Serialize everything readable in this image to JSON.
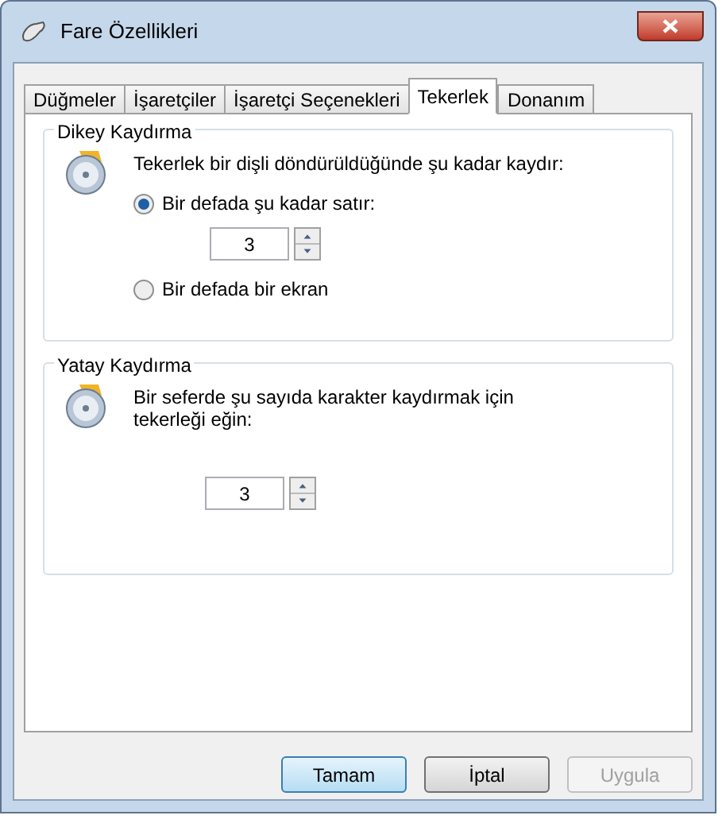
{
  "window": {
    "title": "Fare Özellikleri"
  },
  "tabs": [
    {
      "label": "Düğmeler",
      "selected": false
    },
    {
      "label": "İşaretçiler",
      "selected": false
    },
    {
      "label": "İşaretçi Seçenekleri",
      "selected": false
    },
    {
      "label": "Tekerlek",
      "selected": true
    },
    {
      "label": "Donanım",
      "selected": false
    }
  ],
  "groups": [
    {
      "title": "Dikey Kaydırma",
      "description": "Tekerlek bir dişli döndürüldüğünde şu kadar kaydır:",
      "items": [
        {
          "kind": "radio",
          "label": "Bir defada şu kadar satır:",
          "selected": true
        },
        {
          "kind": "spinner",
          "value": "3"
        },
        {
          "kind": "radio",
          "label": "Bir defada bir ekran",
          "selected": false
        }
      ]
    },
    {
      "title": "Yatay Kaydırma",
      "description": "Bir seferde şu sayıda karakter kaydırmak için tekerleği eğin:",
      "items": [
        {
          "kind": "spinner",
          "value": "3"
        }
      ]
    }
  ],
  "buttons": [
    {
      "label": "Tamam",
      "default": true,
      "disabled": false
    },
    {
      "label": "İptal",
      "default": false,
      "disabled": false
    },
    {
      "label": "Uygula",
      "default": false,
      "disabled": true
    }
  ]
}
